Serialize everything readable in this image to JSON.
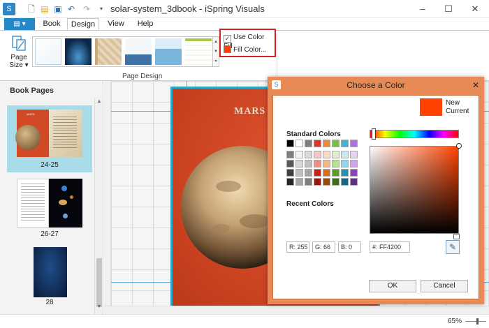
{
  "window": {
    "title": "solar-system_3dbook - iSpring Visuals"
  },
  "ribbon": {
    "tabs": [
      {
        "label": "Book"
      },
      {
        "label": "Design"
      },
      {
        "label": "View"
      },
      {
        "label": "Help"
      }
    ],
    "active_tab": "Design",
    "page_size_label_1": "Page",
    "page_size_label_2": "Size",
    "group_label": "Page Design",
    "use_color_fill_label": "Use Color Fill",
    "use_color_fill_checked": true,
    "fill_color_label": "Fill Color...",
    "fill_color_value": "#ff4200"
  },
  "left_pane": {
    "title": "Book Pages",
    "pages": [
      {
        "label": "24-25",
        "selected": true
      },
      {
        "label": "26-27",
        "selected": false
      },
      {
        "label": "28",
        "selected": false
      }
    ],
    "thumb_heading": "MARS"
  },
  "canvas": {
    "page_title": "MARS",
    "page_color": "#ff4200"
  },
  "status": {
    "zoom": "65%"
  },
  "dialog": {
    "title": "Choose a Color",
    "new_label": "New",
    "current_label": "Current",
    "new_color": "#ff4200",
    "standard_colors_label": "Standard Colors",
    "recent_colors_label": "Recent Colors",
    "r_value": "R: 255",
    "g_value": "G: 66",
    "b_value": "B: 0",
    "hex_value": "#: FF4200",
    "ok_label": "OK",
    "cancel_label": "Cancel",
    "standard_colors_top": [
      "#000000",
      "#ffffff",
      "#7f7f7f",
      "#d9352b",
      "#f28b30",
      "#7ac143",
      "#36b7e0",
      "#b06fdb",
      "#ff3db2",
      "#f5e01a"
    ]
  }
}
